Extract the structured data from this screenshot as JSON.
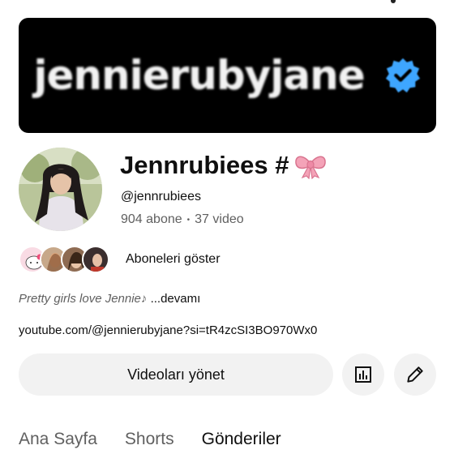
{
  "banner": {
    "text": "jennierubyjane"
  },
  "channel": {
    "name": "Jennrubiees #",
    "handle": "@jennrubiees",
    "subscribers": "904 abone",
    "separator": "•",
    "videos": "37 video"
  },
  "subscribers_row": {
    "label": "Aboneleri göster"
  },
  "description": {
    "text": "Pretty girls love Jennie♪",
    "more": " ...devamı"
  },
  "link": "youtube.com/@jennierubyjane?si=tR4zcSI3BO970Wx0",
  "actions": {
    "manage_label": "Videoları yönet"
  },
  "tabs": [
    {
      "label": "Ana Sayfa"
    },
    {
      "label": "Shorts"
    },
    {
      "label": "Gönderiler"
    }
  ],
  "colors": {
    "badge_blue": "#3ea6ff",
    "bow_pink": "#f4a3b8",
    "button_bg": "#f2f2f2"
  }
}
